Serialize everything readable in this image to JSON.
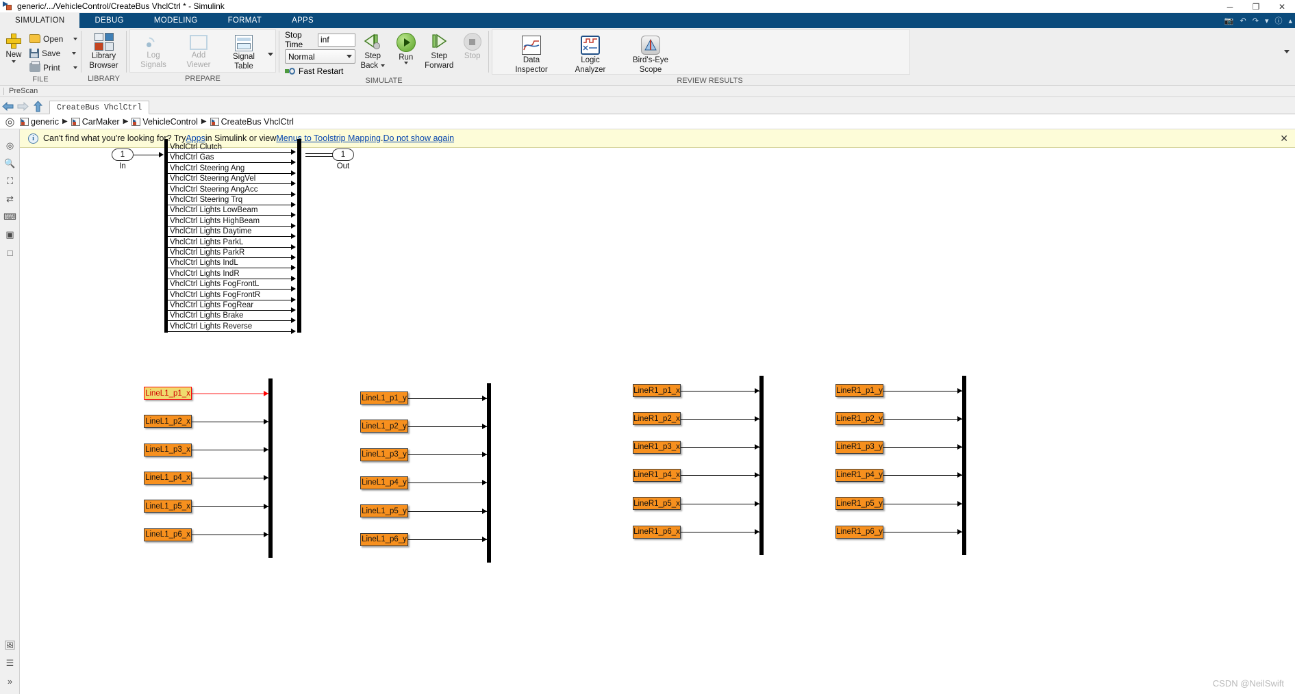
{
  "window": {
    "title": "generic/.../VehicleControl/CreateBus VhclCtrl * - Simulink",
    "icon": "simulink-model-icon",
    "minimize": "─",
    "maximize": "❐",
    "close": "✕"
  },
  "ribbon_tabs": [
    {
      "label": "SIMULATION",
      "active": true
    },
    {
      "label": "DEBUG",
      "active": false
    },
    {
      "label": "MODELING",
      "active": false
    },
    {
      "label": "FORMAT",
      "active": false
    },
    {
      "label": "APPS",
      "active": false
    }
  ],
  "tabstrip_right_icons": [
    "screenshot-icon",
    "undo-icon",
    "redo-icon",
    "customize-icon",
    "help-icon",
    "expand-icon"
  ],
  "ribbon": {
    "groups": [
      {
        "name": "file",
        "label": "FILE",
        "new_button": "New",
        "items": [
          {
            "label": "Open",
            "icon": "folder-icon",
            "has_caret": true
          },
          {
            "label": "Save",
            "icon": "save-icon",
            "has_caret": true
          },
          {
            "label": "Print",
            "icon": "print-icon",
            "has_caret": true
          }
        ]
      },
      {
        "name": "library",
        "label": "LIBRARY",
        "items": [
          {
            "label": "Library\nBrowser",
            "label_l1": "Library",
            "label_l2": "Browser",
            "icon": "library-browser-icon"
          }
        ]
      },
      {
        "name": "prepare",
        "label": "PREPARE",
        "items": [
          {
            "label_l1": "Log",
            "label_l2": "Signals",
            "icon": "log-signals-icon",
            "disabled": true
          },
          {
            "label_l1": "Add",
            "label_l2": "Viewer",
            "icon": "add-viewer-icon",
            "disabled": true
          },
          {
            "label_l1": "Signal",
            "label_l2": "Table",
            "icon": "signal-table-icon",
            "disabled": false
          }
        ]
      },
      {
        "name": "simulate",
        "label": "SIMULATE",
        "stop_time_label": "Stop Time",
        "stop_time_value": "inf",
        "stop_time_placeholder": "inf",
        "mode_value": "Normal",
        "fast_restart_label": "Fast Restart",
        "items": [
          {
            "label_l1": "Step",
            "label_l2": "Back",
            "icon": "step-back-icon",
            "has_caret": true
          },
          {
            "label_l1": "Run",
            "label_l2": "",
            "icon": "run-icon",
            "has_caret": true
          },
          {
            "label_l1": "Step",
            "label_l2": "Forward",
            "icon": "step-forward-icon"
          },
          {
            "label_l1": "Stop",
            "label_l2": "",
            "icon": "stop-icon",
            "disabled": true
          }
        ]
      },
      {
        "name": "review_results",
        "label": "REVIEW RESULTS",
        "items": [
          {
            "label_l1": "Data",
            "label_l2": "Inspector",
            "icon": "data-inspector-icon"
          },
          {
            "label_l1": "Logic",
            "label_l2": "Analyzer",
            "icon": "logic-analyzer-icon"
          },
          {
            "label_l1": "Bird's-Eye",
            "label_l2": "Scope",
            "icon": "birds-eye-scope-icon"
          }
        ]
      }
    ]
  },
  "prescan_bar": {
    "label": "PreScan"
  },
  "nav": {
    "back": "back-arrow-icon",
    "forward": "forward-arrow-icon",
    "up": "up-arrow-icon",
    "model_tab": "CreateBus VhclCtrl"
  },
  "breadcrumb": {
    "items": [
      "generic",
      "CarMaker",
      "VehicleControl",
      "CreateBus VhclCtrl"
    ],
    "separator": "▶"
  },
  "notification": {
    "text_before": "Can't find what you're looking for? Try ",
    "link1": "Apps",
    "text_mid": " in Simulink or view ",
    "link2": "Menus to Toolstrip Mapping",
    "text_after": ". ",
    "link3": "Do not show again",
    "close": "✕"
  },
  "left_rail_icons": [
    "target-icon",
    "zoom-icon",
    "fit-to-view-icon",
    "pan-icon",
    "annotation-icon",
    "image-icon",
    "area-icon",
    "model-explorer-icon",
    "property-inspector-icon",
    "expand-panel-icon"
  ],
  "diagram": {
    "in_port": {
      "number": "1",
      "label": "In"
    },
    "out_port": {
      "number": "1",
      "label": "Out"
    },
    "bus_signals": [
      "VhclCtrl Clutch",
      "VhclCtrl Gas",
      "VhclCtrl Steering Ang",
      "VhclCtrl Steering AngVel",
      "VhclCtrl Steering AngAcc",
      "VhclCtrl Steering Trq",
      "VhclCtrl Lights LowBeam",
      "VhclCtrl Lights HighBeam",
      "VhclCtrl Lights Daytime",
      "VhclCtrl Lights ParkL",
      "VhclCtrl Lights ParkR",
      "VhclCtrl Lights IndL",
      "VhclCtrl Lights IndR",
      "VhclCtrl Lights FogFrontL",
      "VhclCtrl Lights FogFrontR",
      "VhclCtrl Lights FogRear",
      "VhclCtrl Lights Brake",
      "VhclCtrl Lights Reverse"
    ],
    "const_columns": [
      {
        "name": "linel1-x",
        "blocks": [
          "LineL1_p1_x",
          "LineL1_p2_x",
          "LineL1_p3_x",
          "LineL1_p4_x",
          "LineL1_p5_x",
          "LineL1_p6_x"
        ],
        "selected_index": 0
      },
      {
        "name": "linel1-y",
        "blocks": [
          "LineL1_p1_y",
          "LineL1_p2_y",
          "LineL1_p3_y",
          "LineL1_p4_y",
          "LineL1_p5_y",
          "LineL1_p6_y"
        ],
        "selected_index": -1
      },
      {
        "name": "liner1-x",
        "blocks": [
          "LineR1_p1_x",
          "LineR1_p2_x",
          "LineR1_p3_x",
          "LineR1_p4_x",
          "LineR1_p5_x",
          "LineR1_p6_x"
        ],
        "selected_index": -1
      },
      {
        "name": "liner1-y",
        "blocks": [
          "LineR1_p1_y",
          "LineR1_p2_y",
          "LineR1_p3_y",
          "LineR1_p4_y",
          "LineR1_p5_y",
          "LineR1_p6_y"
        ],
        "selected_index": -1
      }
    ]
  },
  "watermark": "CSDN @NeilSwift",
  "colors": {
    "ribbon_blue": "#0b4b7c",
    "const_orange": "#f7901e",
    "selected_yellow": "#efdb6e",
    "selection_red": "#ff0000",
    "notify_bg": "#fdfcd8",
    "link_blue": "#0645ad"
  }
}
